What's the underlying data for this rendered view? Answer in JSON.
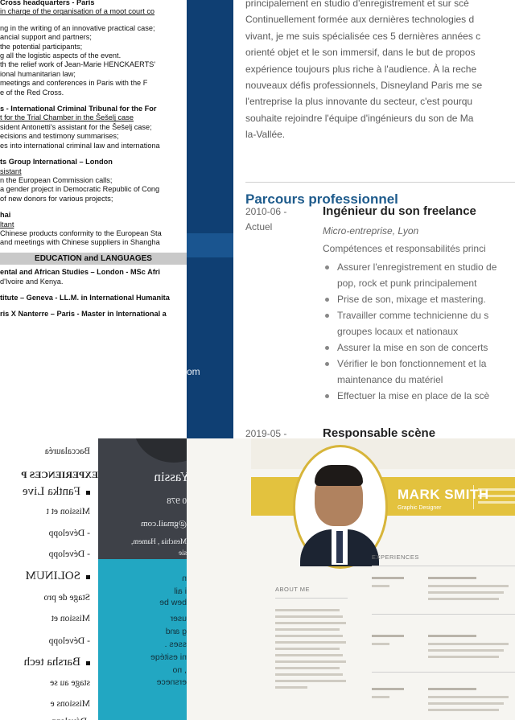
{
  "cv_english": {
    "lines": [
      {
        "text": "Cross headquarters - Paris",
        "style": "b"
      },
      {
        "text": "in charge of the organisation of a moot court co",
        "style": "u"
      },
      {
        "text": "",
        "style": "gap"
      },
      {
        "text": "ng in the writing of an innovative practical case;",
        "style": ""
      },
      {
        "text": "ancial support and partners;",
        "style": ""
      },
      {
        "text": "the potential participants;",
        "style": ""
      },
      {
        "text": "g all the logistic aspects of the event.",
        "style": ""
      },
      {
        "text": "th the relief work of Jean-Marie HENCKAERTS'",
        "style": ""
      },
      {
        "text": "ional humanitarian law;",
        "style": ""
      },
      {
        "text": "meetings and conferences in Paris with the F",
        "style": ""
      },
      {
        "text": "e of the Red Cross.",
        "style": ""
      },
      {
        "text": "",
        "style": "gap"
      },
      {
        "text": "s - International Criminal Tribunal for the For",
        "style": "b"
      },
      {
        "text": "t for the Trial Chamber in the Šešelj case",
        "style": "u"
      },
      {
        "text": "sident Antonetti's assistant for the Šešelj case;",
        "style": ""
      },
      {
        "text": "ecisions and testimony summarises;",
        "style": ""
      },
      {
        "text": "es into international criminal law and internationa",
        "style": ""
      },
      {
        "text": "",
        "style": "gap"
      },
      {
        "text": "ts Group International – London",
        "style": "b"
      },
      {
        "text": "sistant",
        "style": "u"
      },
      {
        "text": "n the European Commission calls;",
        "style": ""
      },
      {
        "text": "a gender project in Democratic Republic of Cong",
        "style": ""
      },
      {
        "text": "of new donors for various projects;",
        "style": ""
      },
      {
        "text": "",
        "style": "gap"
      },
      {
        "text": "hai",
        "style": "b"
      },
      {
        "text": "ltant",
        "style": "u"
      },
      {
        "text": "Chinese products conformity to the European Sta",
        "style": ""
      },
      {
        "text": "and meetings with Chinese suppliers in Shangha",
        "style": ""
      }
    ],
    "education_heading": "EDUCATION and LANGUAGES",
    "education_lines": [
      {
        "text": "ental and African Studies – London - MSc Afri",
        "style": "b"
      },
      {
        "text": "d'Ivoire and Kenya.",
        "style": ""
      },
      {
        "text": "",
        "style": "gap"
      },
      {
        "text": "titute – Geneva - LL.M. in International Humanita",
        "style": "b"
      },
      {
        "text": "",
        "style": "gap"
      },
      {
        "text": "ris X Nanterre – Paris - Master in International a",
        "style": "b"
      }
    ]
  },
  "blue_band": {
    "fragment": "om"
  },
  "cv_french": {
    "intro_lines": [
      "principalement en studio d'enregistrement et sur scè",
      "Continuellement formée aux dernières technologies d",
      "vivant, je me suis spécialisée ces 5 dernières années c",
      "orienté objet et le son immersif, dans le but de propos",
      "expérience toujours plus riche à l'audience. À la reche",
      "nouveaux défis professionnels, Disneyland Paris me se",
      "l'entreprise la plus innovante du secteur, c'est pourqu",
      "souhaite rejoindre l'équipe d'ingénieurs du son de Ma",
      "la-Vallée."
    ],
    "section_title": "Parcours professionnel",
    "jobs": [
      {
        "date": "2010-06 - Actuel",
        "title": "Ingénieur du son freelance",
        "company": "Micro-entreprise, Lyon",
        "responsibilities": "Compétences et responsabilités princi",
        "bullets": [
          {
            "text": "Assurer l'enregistrement en studio de",
            "cont": false
          },
          {
            "text": "pop, rock et punk principalement",
            "cont": true
          },
          {
            "text": "Prise de son, mixage et mastering.",
            "cont": false
          },
          {
            "text": "Travailler comme technicienne du s",
            "cont": false
          },
          {
            "text": "groupes locaux et nationaux",
            "cont": true
          },
          {
            "text": "Assurer la mise en son de concerts",
            "cont": false
          },
          {
            "text": "Vérifier le bon fonctionnement et la",
            "cont": false
          },
          {
            "text": "maintenance du matériel",
            "cont": true
          },
          {
            "text": "Effectuer la mise en place de la scè",
            "cont": false
          }
        ]
      },
      {
        "date": "2019-05 -",
        "title": "Responsable scène"
      }
    ]
  },
  "cv_mirrored_left": {
    "lines": [
      {
        "text": "Baccalauréa",
        "kind": "plain"
      },
      {
        "text": "EXPERIENCES P",
        "kind": "heading"
      },
      {
        "text": "Fantka Live",
        "kind": "bullet"
      },
      {
        "text": "Mission et t",
        "kind": "plain"
      },
      {
        "text": "- Développ",
        "kind": "plain"
      },
      {
        "text": "- Développ",
        "kind": "plain"
      },
      {
        "text": "SOLINUM",
        "kind": "bullet"
      },
      {
        "text": "Stage de pro",
        "kind": "plain"
      },
      {
        "text": "Mission et",
        "kind": "plain"
      },
      {
        "text": "- Développ",
        "kind": "plain"
      },
      {
        "text": "Barsha tech",
        "kind": "bullet"
      },
      {
        "text": "stage au se",
        "kind": "plain"
      },
      {
        "text": "Missions e",
        "kind": "plain"
      },
      {
        "text": "-Développ",
        "kind": "plain"
      }
    ]
  },
  "cv_mirrored_mid": {
    "name": "Yassin",
    "phone_fragment": "0 978",
    "email_fragment": "@gmail.com",
    "address_fragment": "Menchia , Hamem,",
    "address_fragment2": "sie",
    "teal_lines": [
      "n",
      "i ail",
      "bew be",
      "user",
      "g and",
      "sses .",
      "ni esitéqe",
      ", no",
      "ersnece"
    ]
  },
  "cv_mark_smith": {
    "name": "MARK SMITH",
    "subtitle": "Graphic Designer",
    "experiences_label": "EXPERIENCES",
    "about_label": "ABOUT ME"
  }
}
